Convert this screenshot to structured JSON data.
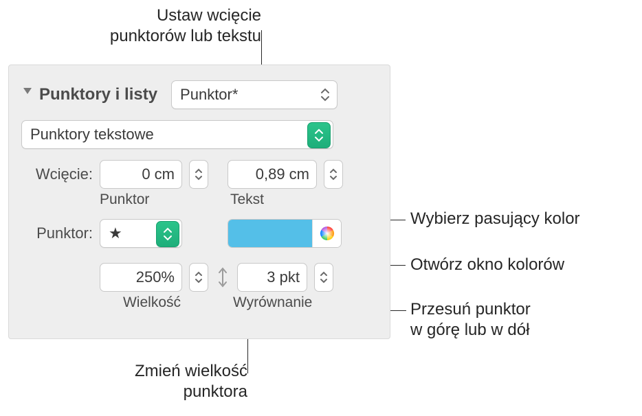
{
  "callouts": {
    "indent": "Ustaw wcięcie\npunktorów lub tekstu",
    "chooseColor": "Wybierz pasujący kolor",
    "openColorWindow": "Otwórz okno kolorów",
    "moveBullet": "Przesuń punktor\nw górę lub w dół",
    "changeSize": "Zmień wielkość\npunktora"
  },
  "panel": {
    "sectionTitle": "Punktory i listy",
    "styleDropdown": "Punktor*",
    "typeDropdown": "Punktory tekstowe",
    "indentLabel": "Wcięcie:",
    "indentBulletValue": "0 cm",
    "indentBulletSub": "Punktor",
    "indentTextValue": "0,89 cm",
    "indentTextSub": "Tekst",
    "bulletLabel": "Punktor:",
    "bulletGlyph": "★",
    "sizeValue": "250%",
    "sizeSub": "Wielkość",
    "alignValue": "3 pkt",
    "alignSub": "Wyrównanie"
  },
  "colors": {
    "swatch": "#54BFE8"
  }
}
